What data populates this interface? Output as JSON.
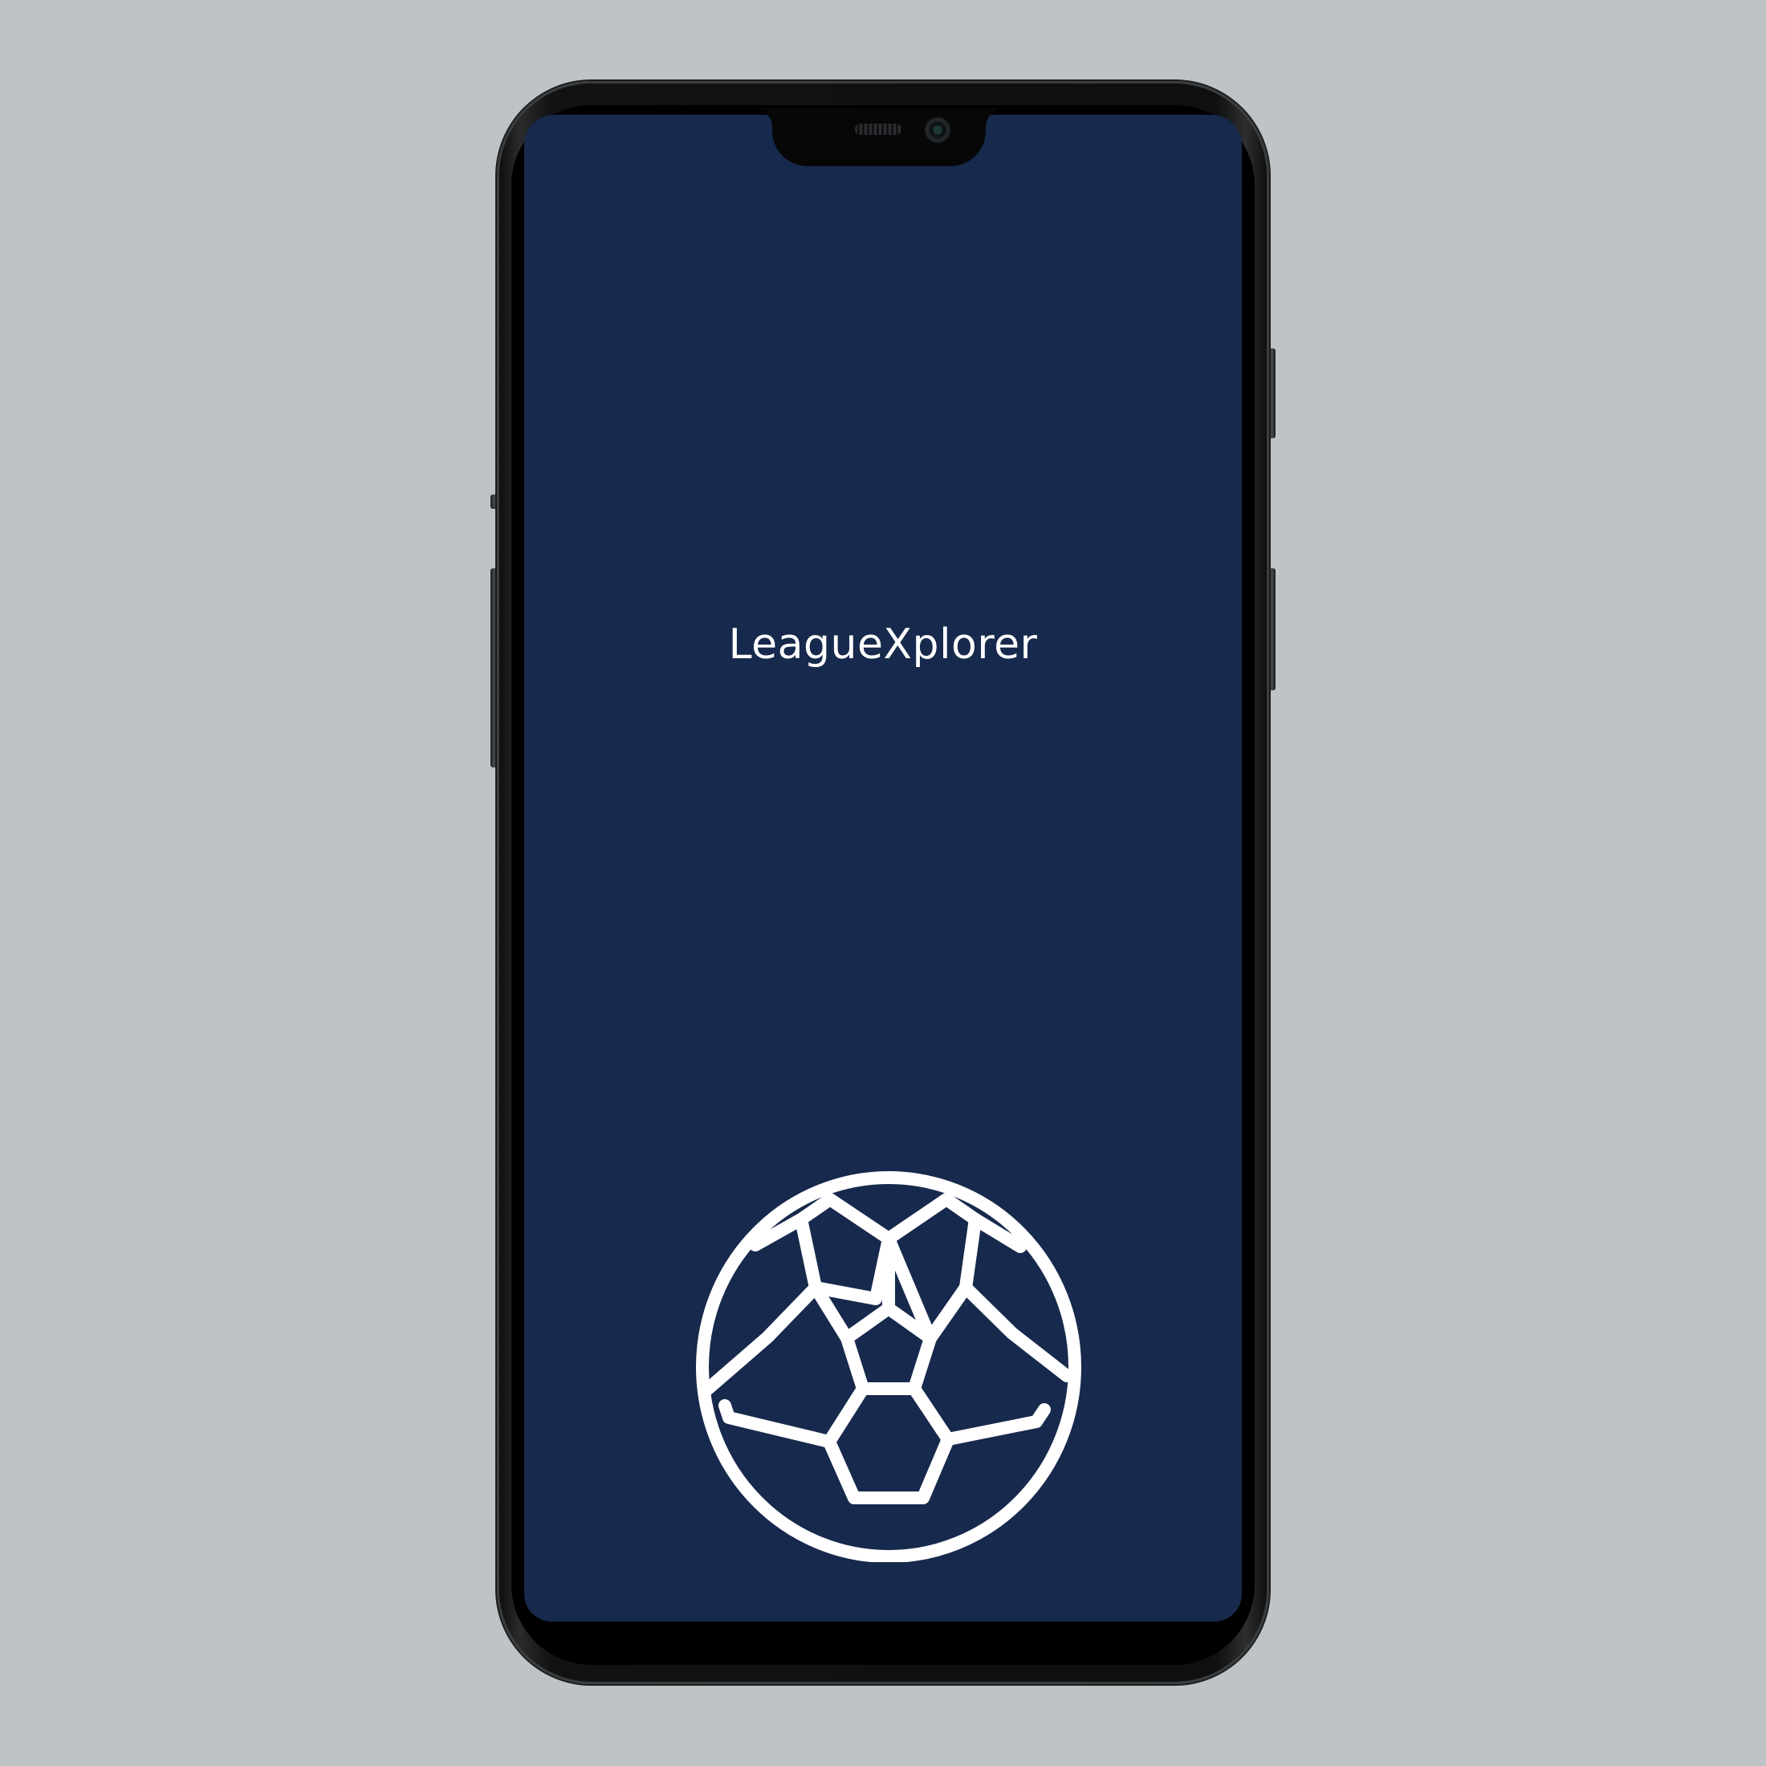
{
  "app": {
    "title": "LeagueXplorer",
    "logo_icon": "soccer-ball-icon"
  },
  "colors": {
    "background": "#bec3c6",
    "screen": "#17294c",
    "title_text": "#ffffff",
    "logo_stroke": "#ffffff",
    "phone_frame": "#0e0f10"
  }
}
